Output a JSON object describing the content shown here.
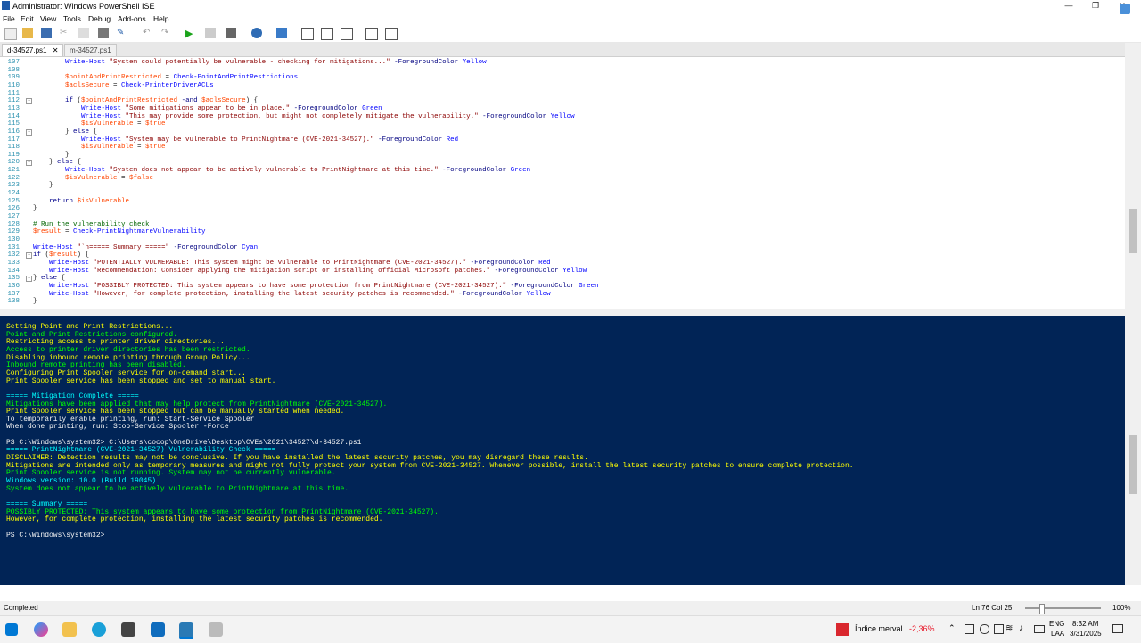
{
  "window": {
    "title": "Administrator: Windows PowerShell ISE"
  },
  "menu": [
    "File",
    "Edit",
    "View",
    "Tools",
    "Debug",
    "Add-ons",
    "Help"
  ],
  "tabs": [
    {
      "label": "d-34527.ps1",
      "close": "✕",
      "active": true
    },
    {
      "label": "m-34527.ps1",
      "active": false
    }
  ],
  "editor_lines": [
    {
      "n": "107",
      "fold": "",
      "tokens": [
        {
          "t": "        ",
          "c": ""
        },
        {
          "t": "Write-Host",
          "c": "cmd"
        },
        {
          "t": " ",
          "c": ""
        },
        {
          "t": "\"System could potentially be vulnerable - checking for mitigations...\"",
          "c": "str"
        },
        {
          "t": " -ForegroundColor",
          "c": "param"
        },
        {
          "t": " Yellow",
          "c": "cmd"
        }
      ]
    },
    {
      "n": "108",
      "fold": "",
      "tokens": []
    },
    {
      "n": "109",
      "fold": "",
      "tokens": [
        {
          "t": "        ",
          "c": ""
        },
        {
          "t": "$pointAndPrintRestricted",
          "c": "var"
        },
        {
          "t": " = ",
          "c": ""
        },
        {
          "t": "Check-PointAndPrintRestrictions",
          "c": "cmd"
        }
      ]
    },
    {
      "n": "110",
      "fold": "",
      "tokens": [
        {
          "t": "        ",
          "c": ""
        },
        {
          "t": "$aclsSecure",
          "c": "var"
        },
        {
          "t": " = ",
          "c": ""
        },
        {
          "t": "Check-PrinterDriverACLs",
          "c": "cmd"
        }
      ]
    },
    {
      "n": "111",
      "fold": "",
      "tokens": []
    },
    {
      "n": "112",
      "fold": "-",
      "tokens": [
        {
          "t": "        ",
          "c": ""
        },
        {
          "t": "if",
          "c": "kw"
        },
        {
          "t": " (",
          "c": ""
        },
        {
          "t": "$pointAndPrintRestricted",
          "c": "var"
        },
        {
          "t": " -and ",
          "c": "param"
        },
        {
          "t": "$aclsSecure",
          "c": "var"
        },
        {
          "t": ") {",
          "c": ""
        }
      ]
    },
    {
      "n": "113",
      "fold": "",
      "tokens": [
        {
          "t": "            ",
          "c": ""
        },
        {
          "t": "Write-Host",
          "c": "cmd"
        },
        {
          "t": " ",
          "c": ""
        },
        {
          "t": "\"Some mitigations appear to be in place.\"",
          "c": "str"
        },
        {
          "t": " -ForegroundColor",
          "c": "param"
        },
        {
          "t": " Green",
          "c": "cmd"
        }
      ]
    },
    {
      "n": "114",
      "fold": "",
      "tokens": [
        {
          "t": "            ",
          "c": ""
        },
        {
          "t": "Write-Host",
          "c": "cmd"
        },
        {
          "t": " ",
          "c": ""
        },
        {
          "t": "\"This may provide some protection, but might not completely mitigate the vulnerability.\"",
          "c": "str"
        },
        {
          "t": " -ForegroundColor",
          "c": "param"
        },
        {
          "t": " Yellow",
          "c": "cmd"
        }
      ]
    },
    {
      "n": "115",
      "fold": "",
      "tokens": [
        {
          "t": "            ",
          "c": ""
        },
        {
          "t": "$isVulnerable",
          "c": "var"
        },
        {
          "t": " = ",
          "c": ""
        },
        {
          "t": "$true",
          "c": "var"
        }
      ]
    },
    {
      "n": "116",
      "fold": "-",
      "tokens": [
        {
          "t": "        } ",
          "c": ""
        },
        {
          "t": "else",
          "c": "kw"
        },
        {
          "t": " {",
          "c": ""
        }
      ]
    },
    {
      "n": "117",
      "fold": "",
      "tokens": [
        {
          "t": "            ",
          "c": ""
        },
        {
          "t": "Write-Host",
          "c": "cmd"
        },
        {
          "t": " ",
          "c": ""
        },
        {
          "t": "\"System may be vulnerable to PrintNightmare (CVE-2021-34527).\"",
          "c": "str"
        },
        {
          "t": " -ForegroundColor",
          "c": "param"
        },
        {
          "t": " Red",
          "c": "cmd"
        }
      ]
    },
    {
      "n": "118",
      "fold": "",
      "tokens": [
        {
          "t": "            ",
          "c": ""
        },
        {
          "t": "$isVulnerable",
          "c": "var"
        },
        {
          "t": " = ",
          "c": ""
        },
        {
          "t": "$true",
          "c": "var"
        }
      ]
    },
    {
      "n": "119",
      "fold": "",
      "tokens": [
        {
          "t": "        }",
          "c": ""
        }
      ]
    },
    {
      "n": "120",
      "fold": "-",
      "tokens": [
        {
          "t": "    } ",
          "c": ""
        },
        {
          "t": "else",
          "c": "kw"
        },
        {
          "t": " {",
          "c": ""
        }
      ]
    },
    {
      "n": "121",
      "fold": "",
      "tokens": [
        {
          "t": "        ",
          "c": ""
        },
        {
          "t": "Write-Host",
          "c": "cmd"
        },
        {
          "t": " ",
          "c": ""
        },
        {
          "t": "\"System does not appear to be actively vulnerable to PrintNightmare at this time.\"",
          "c": "str"
        },
        {
          "t": " -ForegroundColor",
          "c": "param"
        },
        {
          "t": " Green",
          "c": "cmd"
        }
      ]
    },
    {
      "n": "122",
      "fold": "",
      "tokens": [
        {
          "t": "        ",
          "c": ""
        },
        {
          "t": "$isVulnerable",
          "c": "var"
        },
        {
          "t": " = ",
          "c": ""
        },
        {
          "t": "$false",
          "c": "var"
        }
      ]
    },
    {
      "n": "123",
      "fold": "",
      "tokens": [
        {
          "t": "    }",
          "c": ""
        }
      ]
    },
    {
      "n": "124",
      "fold": "",
      "tokens": []
    },
    {
      "n": "125",
      "fold": "",
      "tokens": [
        {
          "t": "    ",
          "c": ""
        },
        {
          "t": "return",
          "c": "kw"
        },
        {
          "t": " ",
          "c": ""
        },
        {
          "t": "$isVulnerable",
          "c": "var"
        }
      ]
    },
    {
      "n": "126",
      "fold": "",
      "tokens": [
        {
          "t": "}",
          "c": ""
        }
      ]
    },
    {
      "n": "127",
      "fold": "",
      "tokens": []
    },
    {
      "n": "128",
      "fold": "",
      "tokens": [
        {
          "t": "# Run the vulnerability check",
          "c": "cm"
        }
      ]
    },
    {
      "n": "129",
      "fold": "",
      "tokens": [
        {
          "t": "$result",
          "c": "var"
        },
        {
          "t": " = ",
          "c": ""
        },
        {
          "t": "Check-PrintNightmareVulnerability",
          "c": "cmd"
        }
      ]
    },
    {
      "n": "130",
      "fold": "",
      "tokens": []
    },
    {
      "n": "131",
      "fold": "",
      "tokens": [
        {
          "t": "Write-Host",
          "c": "cmd"
        },
        {
          "t": " ",
          "c": ""
        },
        {
          "t": "\"`n===== Summary =====\"",
          "c": "str"
        },
        {
          "t": " -ForegroundColor",
          "c": "param"
        },
        {
          "t": " Cyan",
          "c": "cmd"
        }
      ]
    },
    {
      "n": "132",
      "fold": "-",
      "tokens": [
        {
          "t": "if",
          "c": "kw"
        },
        {
          "t": " (",
          "c": ""
        },
        {
          "t": "$result",
          "c": "var"
        },
        {
          "t": ") {",
          "c": ""
        }
      ]
    },
    {
      "n": "133",
      "fold": "",
      "tokens": [
        {
          "t": "    ",
          "c": ""
        },
        {
          "t": "Write-Host",
          "c": "cmd"
        },
        {
          "t": " ",
          "c": ""
        },
        {
          "t": "\"POTENTIALLY VULNERABLE: This system might be vulnerable to PrintNightmare (CVE-2021-34527).\"",
          "c": "str"
        },
        {
          "t": " -ForegroundColor",
          "c": "param"
        },
        {
          "t": " Red",
          "c": "cmd"
        }
      ]
    },
    {
      "n": "134",
      "fold": "",
      "tokens": [
        {
          "t": "    ",
          "c": ""
        },
        {
          "t": "Write-Host",
          "c": "cmd"
        },
        {
          "t": " ",
          "c": ""
        },
        {
          "t": "\"Recommendation: Consider applying the mitigation script or installing official Microsoft patches.\"",
          "c": "str"
        },
        {
          "t": " -ForegroundColor",
          "c": "param"
        },
        {
          "t": " Yellow",
          "c": "cmd"
        }
      ]
    },
    {
      "n": "135",
      "fold": "-",
      "tokens": [
        {
          "t": "} ",
          "c": ""
        },
        {
          "t": "else",
          "c": "kw"
        },
        {
          "t": " {",
          "c": ""
        }
      ]
    },
    {
      "n": "136",
      "fold": "",
      "tokens": [
        {
          "t": "    ",
          "c": ""
        },
        {
          "t": "Write-Host",
          "c": "cmd"
        },
        {
          "t": " ",
          "c": ""
        },
        {
          "t": "\"POSSIBLY PROTECTED: This system appears to have some protection from PrintNightmare (CVE-2021-34527).\"",
          "c": "str"
        },
        {
          "t": " -ForegroundColor",
          "c": "param"
        },
        {
          "t": " Green",
          "c": "cmd"
        }
      ]
    },
    {
      "n": "137",
      "fold": "",
      "tokens": [
        {
          "t": "    ",
          "c": ""
        },
        {
          "t": "Write-Host",
          "c": "cmd"
        },
        {
          "t": " ",
          "c": ""
        },
        {
          "t": "\"However, for complete protection, installing the latest security patches is recommended.\"",
          "c": "str"
        },
        {
          "t": " -ForegroundColor",
          "c": "param"
        },
        {
          "t": " Yellow",
          "c": "cmd"
        }
      ]
    },
    {
      "n": "138",
      "fold": "",
      "tokens": [
        {
          "t": "}",
          "c": ""
        }
      ]
    }
  ],
  "console_lines": [
    {
      "text": "Setting Point and Print Restrictions...",
      "color": "yellow"
    },
    {
      "text": "Point and Print Restrictions configured.",
      "color": "green"
    },
    {
      "text": "Restricting access to printer driver directories...",
      "color": "yellow"
    },
    {
      "text": "Access to printer driver directories has been restricted.",
      "color": "green"
    },
    {
      "text": "Disabling inbound remote printing through Group Policy...",
      "color": "yellow"
    },
    {
      "text": "Inbound remote printing has been disabled.",
      "color": "green"
    },
    {
      "text": "Configuring Print Spooler service for on-demand start...",
      "color": "yellow"
    },
    {
      "text": "Print Spooler service has been stopped and set to manual start.",
      "color": "yellow"
    },
    {
      "text": "",
      "color": "white"
    },
    {
      "text": "===== Mitigation Complete =====",
      "color": "cyan"
    },
    {
      "text": "Mitigations have been applied that may help protect from PrintNightmare (CVE-2021-34527).",
      "color": "green"
    },
    {
      "text": "Print Spooler service has been stopped but can be manually started when needed.",
      "color": "yellow"
    },
    {
      "text": "To temporarily enable printing, run: Start-Service Spooler",
      "color": "white"
    },
    {
      "text": "When done printing, run: Stop-Service Spooler -Force",
      "color": "white"
    },
    {
      "text": "",
      "color": "white"
    },
    {
      "text": "PS C:\\Windows\\system32> C:\\Users\\cocop\\OneDrive\\Desktop\\CVEs\\2021\\34527\\d-34527.ps1",
      "color": "white"
    },
    {
      "text": "===== PrintNightmare (CVE-2021-34527) Vulnerability Check =====",
      "color": "cyan"
    },
    {
      "text": "DISCLAIMER: Detection results may not be conclusive. If you have installed the latest security patches, you may disregard these results.",
      "color": "yellow"
    },
    {
      "text": "Mitigations are intended only as temporary measures and might not fully protect your system from CVE-2021-34527. Whenever possible, install the latest security patches to ensure complete protection.",
      "color": "yellow"
    },
    {
      "text": "Print Spooler service is not running. System may not be currently vulnerable.",
      "color": "green"
    },
    {
      "text": "Windows version: 10.0 (Build 19045)",
      "color": "cyan"
    },
    {
      "text": "System does not appear to be actively vulnerable to PrintNightmare at this time.",
      "color": "green"
    },
    {
      "text": "",
      "color": "white"
    },
    {
      "text": "===== Summary =====",
      "color": "cyan"
    },
    {
      "text": "POSSIBLY PROTECTED: This system appears to have some protection from PrintNightmare (CVE-2021-34527).",
      "color": "green"
    },
    {
      "text": "However, for complete protection, installing the latest security patches is recommended.",
      "color": "yellow"
    },
    {
      "text": "",
      "color": "white"
    },
    {
      "text": "PS C:\\Windows\\system32>",
      "color": "white"
    }
  ],
  "status": {
    "text": "Completed",
    "position": "Ln 76  Col 25",
    "zoom": "100%"
  },
  "taskbar": {
    "stock_name": "Índice merval",
    "stock_change": "-2,36%",
    "lang_top": "ENG",
    "lang_bottom": "LAA",
    "time": "8:32 AM",
    "date": "3/31/2025"
  },
  "colors": {
    "console_bg": "#012456",
    "accent": "#0078d4",
    "negative": "#e81123"
  }
}
